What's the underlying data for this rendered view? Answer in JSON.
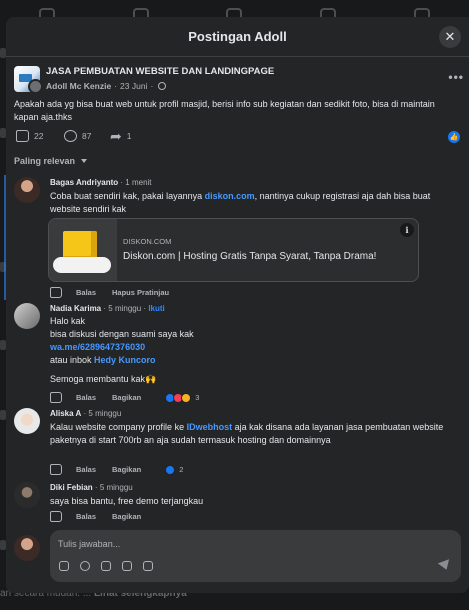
{
  "modal": {
    "title": "Postingan Adoll",
    "close_icon": "close-icon"
  },
  "post": {
    "group": "JASA PEMBUATAN WEBSITE DAN LANDINGPAGE",
    "author": "Adoll Mc Kenzie",
    "dot": "·",
    "date": "23 Juni",
    "text": "Apakah ada yg bisa buat web untuk profil masjid, berisi info sub kegiatan dan sedikit foto, bisa di maintain kapan aja.thks",
    "likes": "22",
    "comments": "87",
    "shares": "1"
  },
  "sort_label": "Paling relevan",
  "comments": [
    {
      "name": "Bagas Andriyanto",
      "time": "1 menit",
      "text_before": "Coba buat sendiri kak, pakai layannya ",
      "link": "diskon.com",
      "text_after": ", nantinya cukup registrasi aja dah bisa buat website sendiri kak",
      "preview_domain": "DISKON.COM",
      "preview_title": "Diskon.com | Hosting Gratis Tanpa Syarat, Tanpa Drama!",
      "reply": "Balas",
      "remove_preview": "Hapus Pratinjau"
    },
    {
      "name": "Nadia Karima",
      "time": "5 minggu",
      "follow": "Ikuti",
      "line1": "Halo kak",
      "line2": "bisa diskusi dengan suami saya kak",
      "link": "wa.me/6289647376030",
      "line3": "atau inbok ",
      "mention": "Hedy Kuncoro",
      "line4": "Semoga membantu kak🙌",
      "reply": "Balas",
      "share": "Bagikan",
      "reactions": "3"
    },
    {
      "name": "Aliska A",
      "time": "5 minggu",
      "text_before": "Kalau website company profile ke ",
      "link": "IDwebhost",
      "text_after": " aja kak disana ada layanan jasa pembuatan website paketnya di start 700rb an aja sudah termasuk hosting dan domainnya",
      "reply": "Balas",
      "share": "Bagikan",
      "reactions": "2"
    },
    {
      "name": "Diki Febian",
      "time": "5 minggu",
      "text": "saya bisa bantu, free demo terjangkau",
      "reply": "Balas",
      "share": "Bagikan"
    }
  ],
  "reply_placeholder": "Tulis jawaban...",
  "background_footer": {
    "text": "an secara mudah. ... ",
    "link": "Lihat selengkapnya"
  },
  "colors": {
    "link": "#4599ff",
    "like_blue": "#1877f2",
    "surface": "#242526",
    "backdrop": "#18191a"
  }
}
